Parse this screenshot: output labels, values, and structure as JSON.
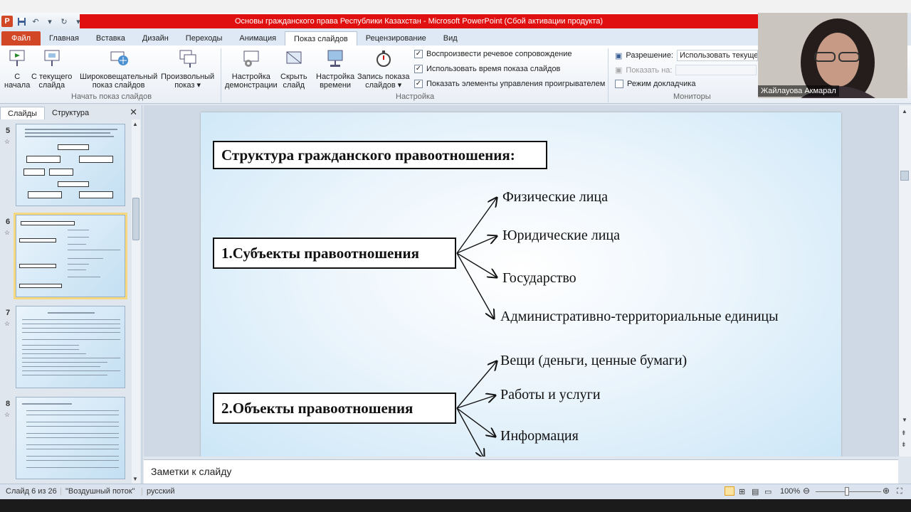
{
  "window": {
    "title": "Основы гражданского права Республики Казахстан  -  Microsoft PowerPoint (Сбой активации продукта)",
    "app_icon": "P"
  },
  "tabs": [
    "Файл",
    "Главная",
    "Вставка",
    "Дизайн",
    "Переходы",
    "Анимация",
    "Показ слайдов",
    "Рецензирование",
    "Вид"
  ],
  "ribbon": {
    "start_group": {
      "label": "Начать показ слайдов",
      "buttons": [
        {
          "line1": "С",
          "line2": "начала"
        },
        {
          "line1": "С текущего",
          "line2": "слайда"
        },
        {
          "line1": "Широковещательный",
          "line2": "показ слайдов"
        },
        {
          "line1": "Произвольный",
          "line2": "показ ▾"
        }
      ]
    },
    "setup_group": {
      "label": "Настройка",
      "buttons": [
        {
          "line1": "Настройка",
          "line2": "демонстрации"
        },
        {
          "line1": "Скрыть",
          "line2": "слайд"
        },
        {
          "line1": "Настройка",
          "line2": "времени"
        },
        {
          "line1": "Запись показа",
          "line2": "слайдов ▾"
        }
      ],
      "checkboxes": [
        {
          "label": "Воспроизвести речевое сопровождение",
          "checked": "✓"
        },
        {
          "label": "Использовать время показа слайдов",
          "checked": "✓"
        },
        {
          "label": "Показать элементы управления проигрывателем",
          "checked": "✓"
        }
      ]
    },
    "monitors_group": {
      "label": "Мониторы",
      "resolution_label": "Разрешение:",
      "resolution_value": "Использовать текуще...",
      "show_on_label": "Показать на:",
      "presenter_label": "Режим докладчика"
    }
  },
  "webcam": {
    "name": "Жайлауова Акмарал"
  },
  "left_panel": {
    "tabs": [
      "Слайды",
      "Структура"
    ],
    "close": "✕",
    "slide_numbers": [
      "5",
      "6",
      "7",
      "8"
    ]
  },
  "slide": {
    "title": "Структура гражданского правоотношения:",
    "box1": "1.Субъекты правоотношения",
    "box2": "2.Объекты правоотношения",
    "subjects": [
      "Физические лица",
      "Юридические лица",
      "Государство",
      "Административно-территориальные единицы"
    ],
    "objects": [
      "Вещи (деньги, ценные бумаги)",
      "Работы и услуги",
      "Информация"
    ]
  },
  "notes": {
    "placeholder": "Заметки к слайду"
  },
  "status": {
    "slide_counter": "Слайд 6 из 26",
    "theme": "\"Воздушный поток\"",
    "language": "русский",
    "zoom": "100%"
  }
}
